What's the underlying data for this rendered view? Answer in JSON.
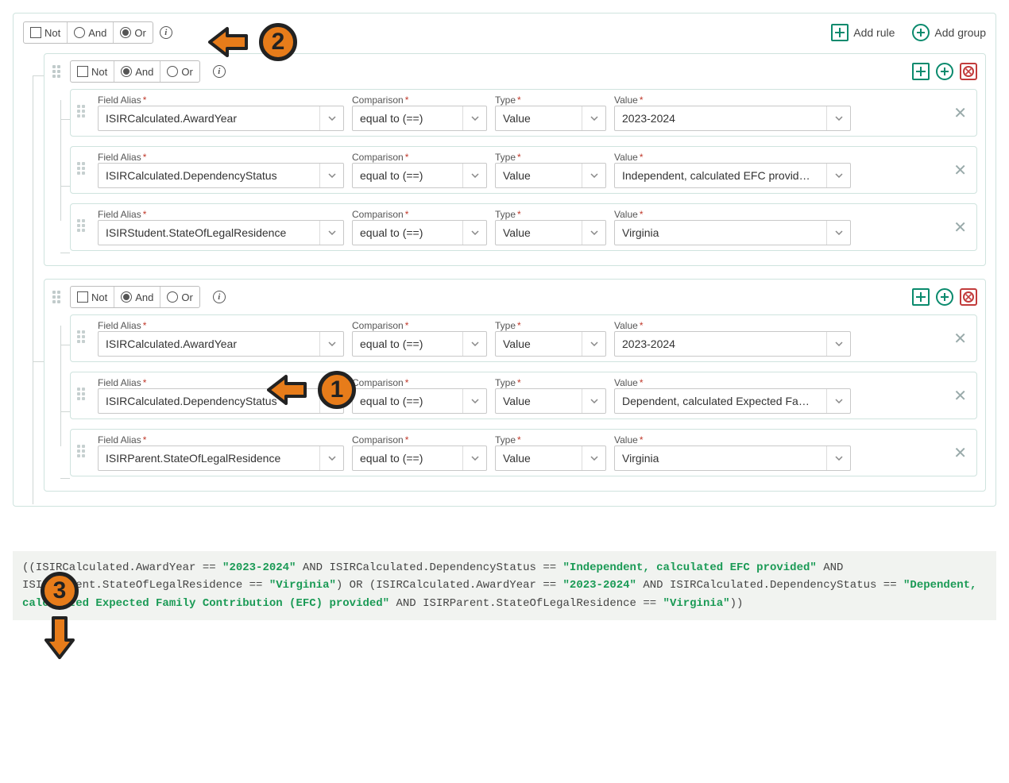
{
  "labels": {
    "not": "Not",
    "and": "And",
    "or": "Or",
    "addRule": "Add rule",
    "addGroup": "Add group",
    "fieldAlias": "Field Alias",
    "comparison": "Comparison",
    "type": "Type",
    "value": "Value"
  },
  "root": {
    "logic": "Or",
    "notChecked": false
  },
  "groups": [
    {
      "logic": "And",
      "notChecked": false,
      "rules": [
        {
          "field": "ISIRCalculated.AwardYear",
          "comparison": "equal to (==)",
          "type": "Value",
          "value": "2023-2024"
        },
        {
          "field": "ISIRCalculated.DependencyStatus",
          "comparison": "equal to (==)",
          "type": "Value",
          "value": "Independent, calculated EFC provid…"
        },
        {
          "field": "ISIRStudent.StateOfLegalResidence",
          "comparison": "equal to (==)",
          "type": "Value",
          "value": "Virginia"
        }
      ]
    },
    {
      "logic": "And",
      "notChecked": false,
      "rules": [
        {
          "field": "ISIRCalculated.AwardYear",
          "comparison": "equal to (==)",
          "type": "Value",
          "value": "2023-2024"
        },
        {
          "field": "ISIRCalculated.DependencyStatus",
          "comparison": "equal to (==)",
          "type": "Value",
          "value": "Dependent, calculated Expected Fa…"
        },
        {
          "field": "ISIRParent.StateOfLegalResidence",
          "comparison": "equal to (==)",
          "type": "Value",
          "value": "Virginia"
        }
      ]
    }
  ],
  "annotations": {
    "n1": "1",
    "n2": "2",
    "n3": "3"
  },
  "expression": {
    "parts": [
      {
        "t": "plain",
        "v": "((ISIRCalculated.AwardYear == "
      },
      {
        "t": "str",
        "v": "\"2023-2024\""
      },
      {
        "t": "plain",
        "v": " AND ISIRCalculated.DependencyStatus == "
      },
      {
        "t": "str",
        "v": "\"Independent, calculated EFC provided\""
      },
      {
        "t": "plain",
        "v": " AND ISIRStudent.StateOfLegalResidence == "
      },
      {
        "t": "str",
        "v": "\"Virginia\""
      },
      {
        "t": "plain",
        "v": ") OR (ISIRCalculated.AwardYear == "
      },
      {
        "t": "str",
        "v": "\"2023-2024\""
      },
      {
        "t": "plain",
        "v": " AND ISIRCalculated.DependencyStatus == "
      },
      {
        "t": "str",
        "v": "\"Dependent, calculated Expected Family Contribution (EFC) provided\""
      },
      {
        "t": "plain",
        "v": " AND ISIRParent.StateOfLegalResidence == "
      },
      {
        "t": "str",
        "v": "\"Virginia\""
      },
      {
        "t": "plain",
        "v": "))"
      }
    ]
  }
}
